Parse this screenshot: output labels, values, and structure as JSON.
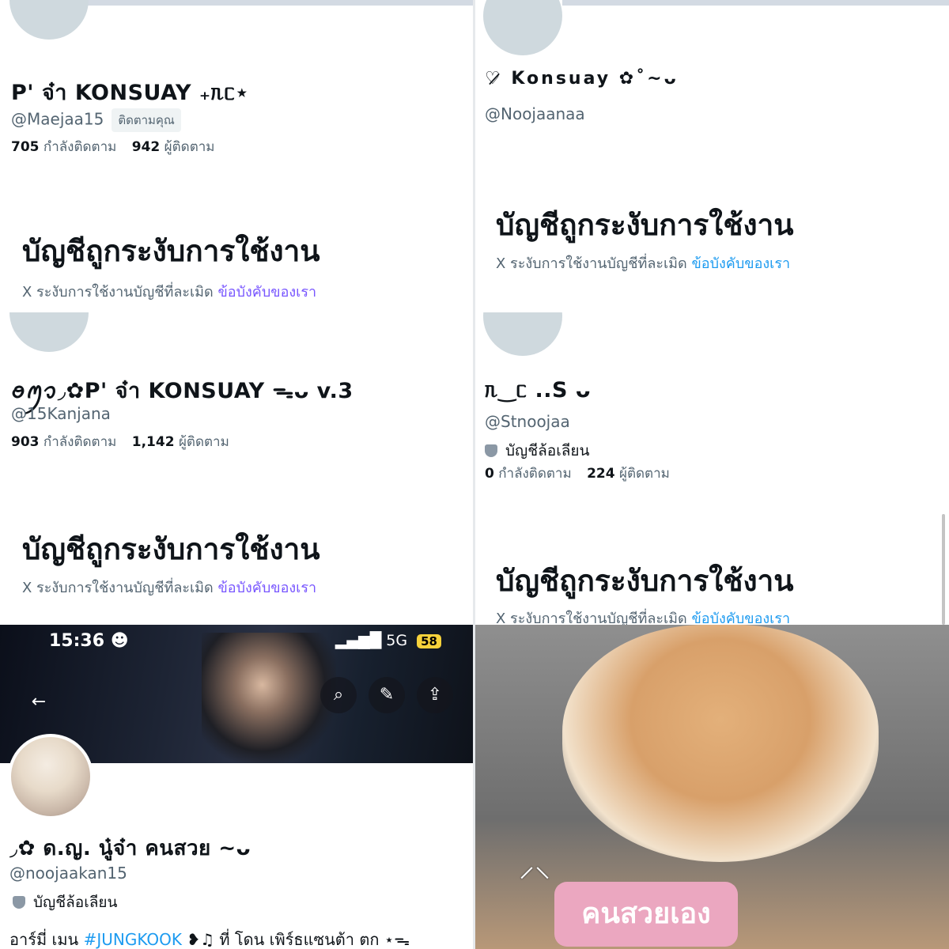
{
  "panels": [
    {
      "name": "P' จ๋า KONSUAY ₊ᥰᥴ⋆",
      "handle": "@Maejaa15",
      "badge": "ติดตามคุณ",
      "following_count": "705",
      "following_label": "กำลังติดตาม",
      "followers_count": "942",
      "followers_label": "ผู้ติดตาม",
      "suspended_title": "บัญชีถูกระงับการใช้งาน",
      "suspended_text": "X ระงับการใช้งานบัญชีที่ละเมิด",
      "suspended_link": "ข้อบังคับของเรา"
    },
    {
      "name": "♡̷̷ Konsuay ✿˚~ᴗ",
      "handle": "@Noojaanaa",
      "suspended_title": "บัญชีถูกระงับการใช้งาน",
      "suspended_text": "X ระงับการใช้งานบัญชีที่ละเมิด",
      "suspended_link": "ข้อบังคับของเรา"
    },
    {
      "name": "ꪮꪑꪫ◞✿P' จ๋า KONSUAY ᯓᴗ v.3",
      "handle": "@15Kanjana",
      "following_count": "903",
      "following_label": "กำลังติดตาม",
      "followers_count": "1,142",
      "followers_label": "ผู้ติดตาม",
      "suspended_title": "บัญชีถูกระงับการใช้งาน",
      "suspended_text": "X ระงับการใช้งานบัญชีที่ละเมิด",
      "suspended_link": "ข้อบังคับของเรา"
    },
    {
      "name": "ᥰ‿ᥴ ..S ᴗ",
      "handle": "@Stnoojaa",
      "parody": "บัญชีล้อเลียน",
      "following_count": "0",
      "following_label": "กำลังติดตาม",
      "followers_count": "224",
      "followers_label": "ผู้ติดตาม",
      "suspended_title": "บัญชีถูกระงับการใช้งาน",
      "suspended_text": "X ระงับการใช้งานบัญชีที่ละเมิด",
      "suspended_link": "ข้อบังคับของเรา"
    }
  ],
  "phone": {
    "time": "15:36 ☻",
    "signal": "5G",
    "battery": "58",
    "name": "◞✿ ด.ญ. นู๋จ๋า คนสวย ~ᴗ",
    "handle": "@noojaakan15",
    "parody": "บัญชีล้อเลียน",
    "bio_prefix": "อาร์มี่ เมน",
    "bio_hashtag": "#JUNGKOOK",
    "bio_suffix": "❥♫ ที่ โดน เพิร์ธแซนต้า ตก ⋆ᯓ",
    "icons": {
      "back": "back-arrow-icon",
      "search": "search-icon",
      "edit": "pencil-icon",
      "share": "share-icon"
    }
  },
  "cat_sticker": "คนสวยเอง",
  "colors": {
    "link_purple": "#7856ff",
    "link_blue": "#1d9bf0",
    "muted": "#536471"
  }
}
